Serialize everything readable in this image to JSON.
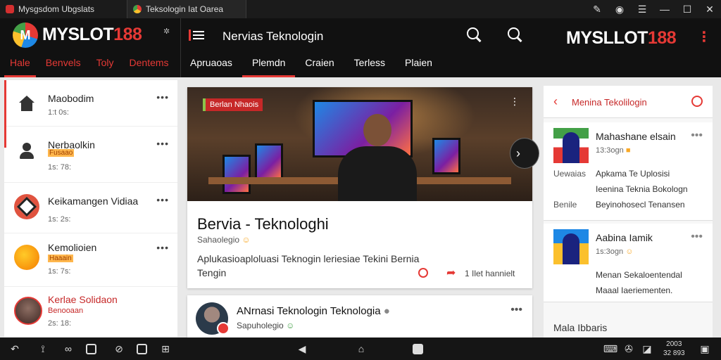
{
  "titlebar": {
    "tab1_title": "Mysgsdom Ubgslats",
    "tab2_title": "Teksologin Iat Oarea"
  },
  "header": {
    "logo_main": "MYSLOT",
    "logo_accent": "188",
    "left_nav": [
      "Hale",
      "Benvels",
      "Toly",
      "Dentems"
    ],
    "page_title": "Nervias Teknologin",
    "main_nav": [
      "Apruaoas",
      "Plemdn",
      "Craien",
      "Terless",
      "Plaien"
    ],
    "brand_right_main": "MYSLLOT",
    "brand_right_accent": "188"
  },
  "sidebar": {
    "items": [
      {
        "title": "Maobodim",
        "meta": "1:t 0s:",
        "tag": ""
      },
      {
        "title": "Nerbaolkin",
        "meta": "1s: 78:",
        "tag": "Fusaao"
      },
      {
        "title": "Keikamangen Vidiaa",
        "meta": "1s: 2s:",
        "tag": ""
      },
      {
        "title": "Kemolioien",
        "meta": "1s: 7s:",
        "tag": "Haaain"
      },
      {
        "title": "Kerlae Solidaon",
        "meta": "2s: 18:",
        "tag": "Benooaan"
      }
    ]
  },
  "hero": {
    "badge": "Berlan Nhaois",
    "title": "Bervia - Teknologhi",
    "subtitle": "Sahaolegio",
    "description": "Aplukasioaploluasi Teknogin leriesiae Tekini Bernia Tengin",
    "action": "1 Ilet hannielt"
  },
  "post": {
    "title": "ANrnasi Teknologin Teknologia",
    "subtitle": "Sapuholegio"
  },
  "right_panel": {
    "title": "Menina Tekolilogin",
    "items": [
      {
        "name": "Mahashane elsain",
        "meta": "13:3ogn",
        "label1": "Uewaias",
        "text1": "Apkama Te Uplosisi",
        "text2": "Ieenina Teknia Bokologn",
        "label2": "Benile",
        "text3": "Beyinohosecl Tenansen"
      },
      {
        "name": "Aabina Iamik",
        "meta": "1s:3ogn",
        "text1": "Menan Sekaloentendal",
        "text2": "Maaal Iaeriementen."
      }
    ],
    "footer": "Mala Ibbaris"
  },
  "taskbar": {
    "time": "2003",
    "date": "32 893"
  }
}
